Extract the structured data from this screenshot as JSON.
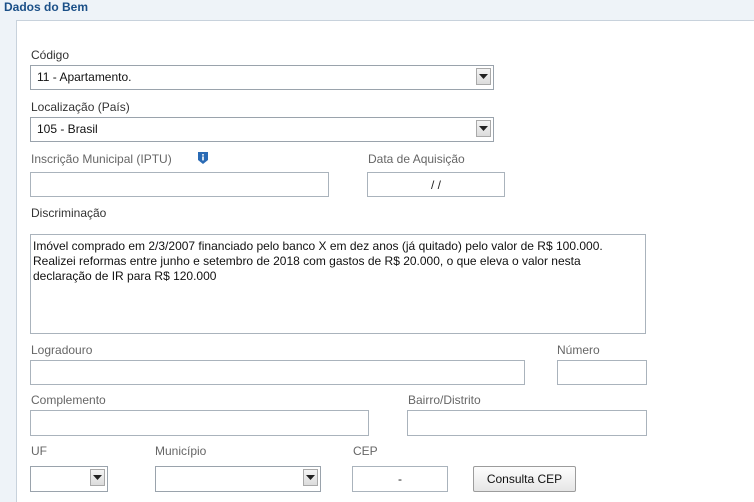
{
  "section": {
    "title": "Dados do Bem"
  },
  "codigo": {
    "label": "Código",
    "value": "11 - Apartamento."
  },
  "localizacao": {
    "label": "Localização (País)",
    "value": "105 - Brasil"
  },
  "inscricao": {
    "label": "Inscrição Municipal (IPTU)",
    "value": ""
  },
  "data_aquisicao": {
    "label": "Data de Aquisição",
    "value": "/ /"
  },
  "discriminacao": {
    "label": "Discriminação",
    "value": "Imóvel comprado em 2/3/2007 financiado pelo banco X em dez anos (já quitado) pelo valor de R$ 100.000.\nRealizei reformas entre junho e setembro de 2018 com gastos de R$ 20.000, o que eleva o valor nesta\ndeclaração de IR para R$ 120.000"
  },
  "logradouro": {
    "label": "Logradouro",
    "value": ""
  },
  "numero": {
    "label": "Número",
    "value": ""
  },
  "complemento": {
    "label": "Complemento",
    "value": ""
  },
  "bairro": {
    "label": "Bairro/Distrito",
    "value": ""
  },
  "uf": {
    "label": "UF",
    "value": ""
  },
  "municipio": {
    "label": "Município",
    "value": ""
  },
  "cep": {
    "label": "CEP",
    "value": "-"
  },
  "consulta_cep": {
    "label": "Consulta CEP"
  },
  "icons": {
    "info": "info-icon",
    "dropdown": "chevron-down-icon"
  },
  "colors": {
    "title": "#1a4f87",
    "info_icon": "#2a6bb5"
  }
}
